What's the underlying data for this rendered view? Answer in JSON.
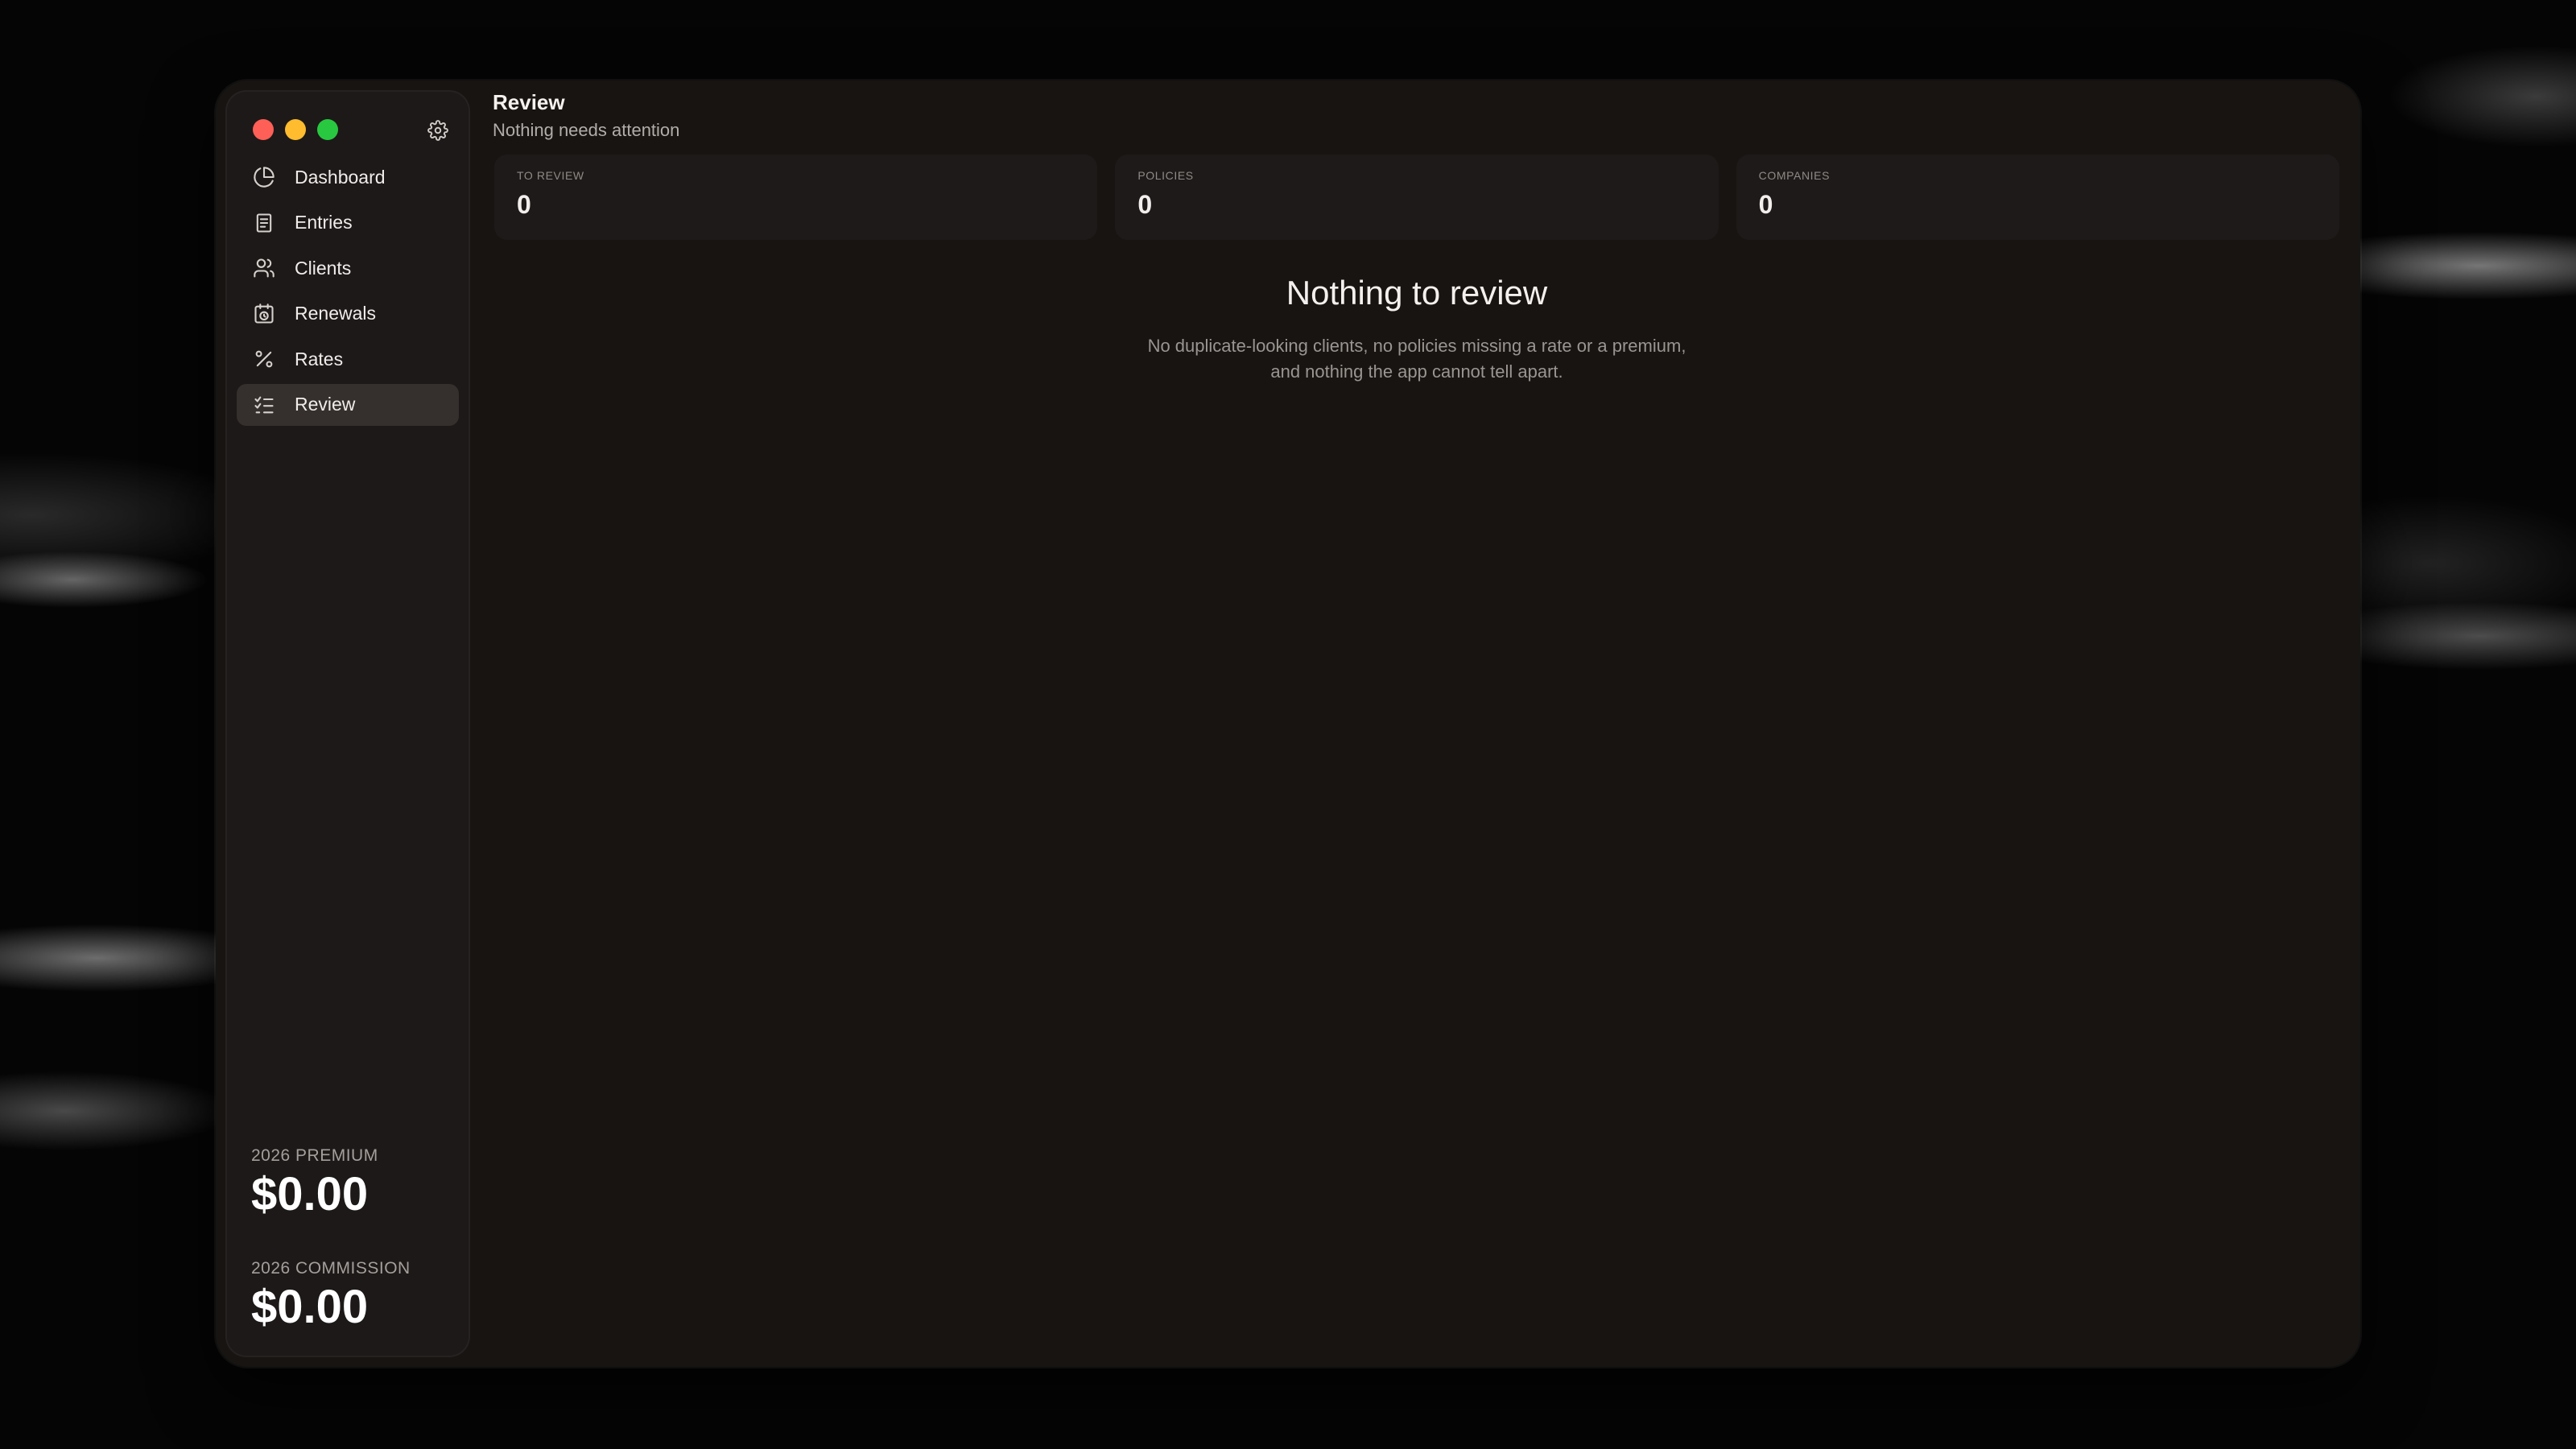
{
  "window": {
    "traffic_lights": {
      "close": "#fe5f57",
      "minimize": "#febc2e",
      "maximize": "#28c840"
    }
  },
  "sidebar": {
    "settings_icon": "gear-icon",
    "items": [
      {
        "label": "Dashboard",
        "icon": "pie-chart-icon",
        "active": false
      },
      {
        "label": "Entries",
        "icon": "document-icon",
        "active": false
      },
      {
        "label": "Clients",
        "icon": "users-icon",
        "active": false
      },
      {
        "label": "Renewals",
        "icon": "calendar-clock-icon",
        "active": false
      },
      {
        "label": "Rates",
        "icon": "percent-icon",
        "active": false
      },
      {
        "label": "Review",
        "icon": "list-checks-icon",
        "active": true
      }
    ],
    "stats": {
      "premium_label": "2026 PREMIUM",
      "premium_value": "$0.00",
      "commission_label": "2026 COMMISSION",
      "commission_value": "$0.00"
    }
  },
  "header": {
    "title": "Review",
    "subtitle": "Nothing needs attention"
  },
  "cards": [
    {
      "label": "TO REVIEW",
      "value": "0"
    },
    {
      "label": "POLICIES",
      "value": "0"
    },
    {
      "label": "COMPANIES",
      "value": "0"
    }
  ],
  "empty_state": {
    "title": "Nothing to review",
    "description": "No duplicate-looking clients, no policies missing a rate or a premium, and nothing the app cannot tell apart."
  },
  "colors": {
    "window_bg": "#171412",
    "sidebar_bg": "#1d1918",
    "active_item_bg": "#35302e",
    "card_bg": "#1e1a19"
  }
}
